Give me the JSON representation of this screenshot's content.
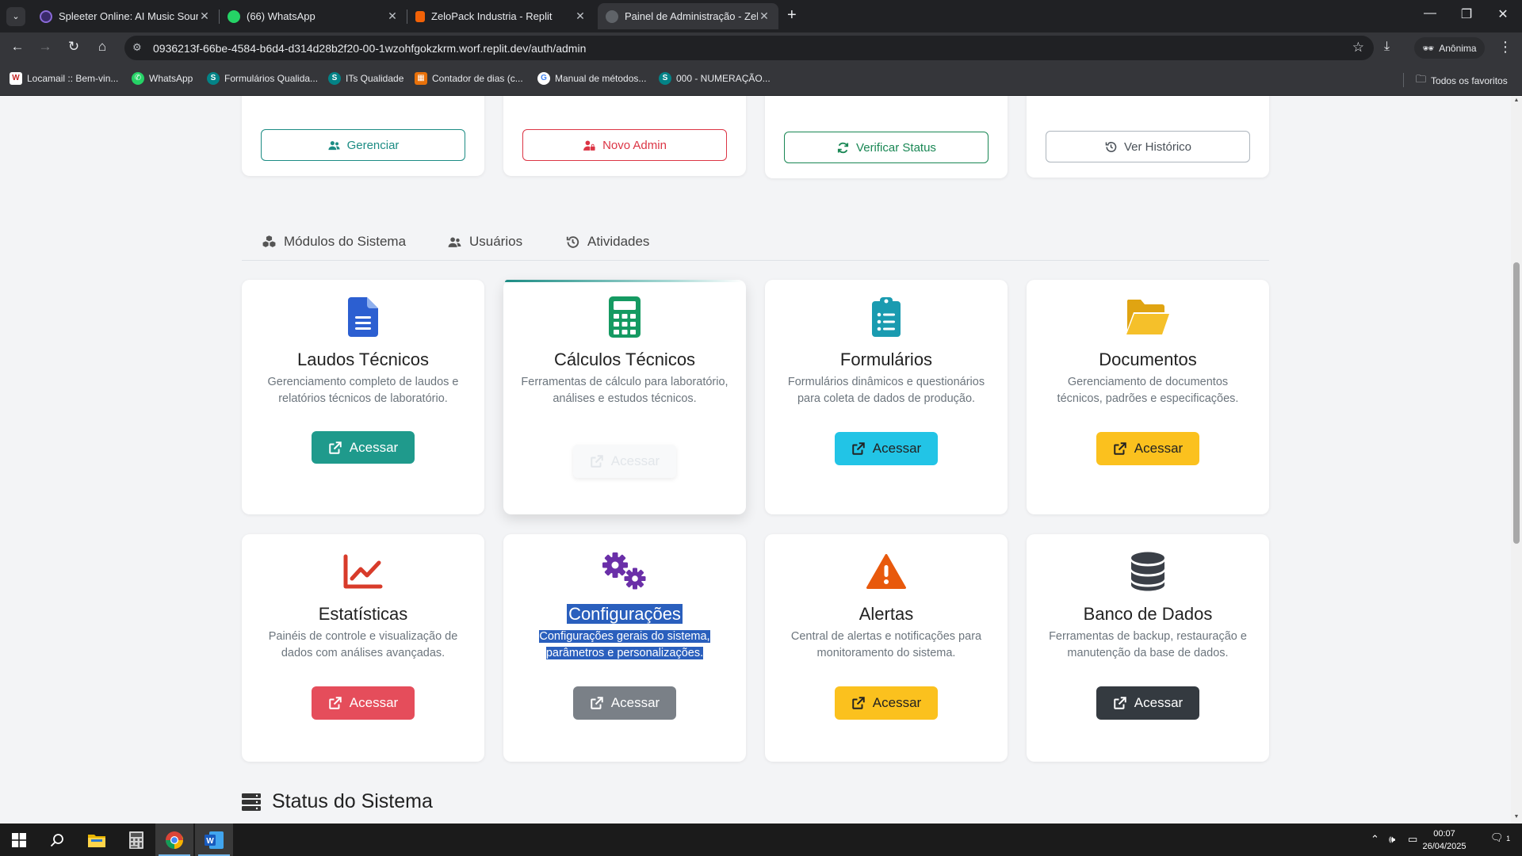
{
  "browser": {
    "tabs": [
      {
        "title": "Spleeter Online: AI Music Sourc",
        "active": false,
        "favicon_color": "#3a2a6a"
      },
      {
        "title": "(66) WhatsApp",
        "active": false,
        "favicon_color": "#25d366"
      },
      {
        "title": "ZeloPack Industria - Replit",
        "active": false,
        "favicon_color": "#f26207"
      },
      {
        "title": "Painel de Administração - Zelop",
        "active": true,
        "favicon_color": "#9aa0a6"
      }
    ],
    "url": "0936213f-66be-4584-b6d4-d314d28b2f20-00-1wzohfgokzkrm.worf.replit.dev/auth/admin",
    "profile_label": "Anônima",
    "bookmarks": [
      {
        "label": "Locamail :: Bem-vin...",
        "icon": "locamail-icon",
        "color": "#c62828",
        "glyph": "W"
      },
      {
        "label": "WhatsApp",
        "icon": "whatsapp-icon",
        "color": "#25d366",
        "glyph": "✆"
      },
      {
        "label": "Formulários Qualida...",
        "icon": "sharepoint-icon",
        "color": "#038387",
        "glyph": "S"
      },
      {
        "label": "ITs Qualidade",
        "icon": "sharepoint-icon",
        "color": "#038387",
        "glyph": "S"
      },
      {
        "label": "Contador de dias (c...",
        "icon": "calendar-icon",
        "color": "#e8710a",
        "glyph": "▦"
      },
      {
        "label": "Manual de métodos...",
        "icon": "google-icon",
        "color": "#ffffff",
        "glyph": "G"
      },
      {
        "label": "000 - NUMERAÇÃO...",
        "icon": "sharepoint-icon",
        "color": "#038387",
        "glyph": "S"
      }
    ],
    "favorites_folder": "Todos os favoritos"
  },
  "top_actions": [
    {
      "label": "Gerenciar",
      "icon": "users-icon",
      "color": "#1c8c84"
    },
    {
      "label": "Novo Admin",
      "icon": "user-lock-icon",
      "color": "#dc3545"
    },
    {
      "label": "Verificar Status",
      "icon": "sync-icon",
      "color": "#198754"
    },
    {
      "label": "Ver Histórico",
      "icon": "history-icon",
      "color": "#495057"
    }
  ],
  "nav_tabs": [
    {
      "label": "Módulos do Sistema",
      "icon": "cubes-icon"
    },
    {
      "label": "Usuários",
      "icon": "users-icon"
    },
    {
      "label": "Atividades",
      "icon": "history-icon"
    }
  ],
  "modules": [
    {
      "title": "Laudos Técnicos",
      "desc": "Gerenciamento completo de laudos e relatórios técnicos de laboratório.",
      "icon": "file-icon",
      "icon_color": "#2c5fd1",
      "button": "Acessar",
      "button_color": "#1f9a8c"
    },
    {
      "title": "Cálculos Técnicos",
      "desc": "Ferramentas de cálculo para laboratório, análises e estudos técnicos.",
      "icon": "calculator-icon",
      "icon_color": "#159a62",
      "button": "Acessar",
      "button_color": "#f8f9fa"
    },
    {
      "title": "Formulários",
      "desc": "Formulários dinâmicos e questionários para coleta de dados de produção.",
      "icon": "clipboard-list-icon",
      "icon_color": "#1a9bb0",
      "button": "Acessar",
      "button_color": "#22c4e6"
    },
    {
      "title": "Documentos",
      "desc": "Gerenciamento de documentos técnicos, padrões e especificações.",
      "icon": "folder-open-icon",
      "icon_color": "#f2b51a",
      "button": "Acessar",
      "button_color": "#fbc11e"
    },
    {
      "title": "Estatísticas",
      "desc": "Painéis de controle e visualização de dados com análises avançadas.",
      "icon": "chart-line-icon",
      "icon_color": "#d83b2a",
      "button": "Acessar",
      "button_color": "#e54d5b"
    },
    {
      "title": "Configurações",
      "desc_line1": "Configurações gerais do sistema,",
      "desc_line2": "parâmetros e personalizações.",
      "icon": "cogs-icon",
      "icon_color": "#6a2fa8",
      "button": "Acessar",
      "button_color": "#7a8087"
    },
    {
      "title": "Alertas",
      "desc": "Central de alertas e notificações para monitoramento do sistema.",
      "icon": "warning-icon",
      "icon_color": "#e8590c",
      "button": "Acessar",
      "button_color": "#fbc11e"
    },
    {
      "title": "Banco de Dados",
      "desc": "Ferramentas de backup, restauração e manutenção da base de dados.",
      "icon": "database-icon",
      "icon_color": "#3a3f47",
      "button": "Acessar",
      "button_color": "#343a40"
    }
  ],
  "status_section": {
    "title": "Status do Sistema",
    "icon": "server-icon"
  },
  "taskbar": {
    "time": "00:07",
    "date": "26/04/2025",
    "notification_count": "1"
  }
}
